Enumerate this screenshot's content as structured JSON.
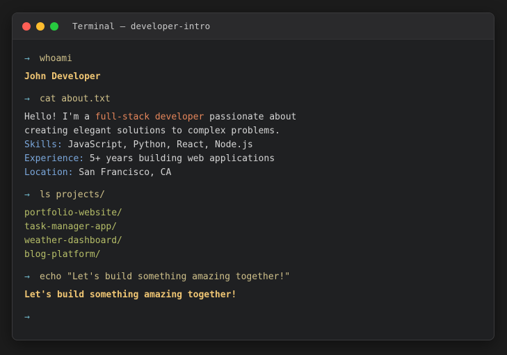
{
  "window": {
    "title": "Terminal — developer-intro"
  },
  "prompt_symbol": "→",
  "session": {
    "whoami": {
      "command": "whoami",
      "output": "John Developer"
    },
    "about": {
      "command": "cat about.txt",
      "intro_prefix": "Hello! I'm a ",
      "intro_highlight": "full-stack developer",
      "intro_suffix": " passionate about",
      "intro_line2": "creating elegant solutions to complex problems.",
      "skills_label": "Skills:",
      "skills_value": " JavaScript, Python, React, Node.js",
      "experience_label": "Experience:",
      "experience_value": " 5+ years building web applications",
      "location_label": "Location:",
      "location_value": " San Francisco, CA"
    },
    "projects": {
      "command": "ls projects/",
      "items": [
        "portfolio-website/",
        "task-manager-app/",
        "weather-dashboard/",
        "blog-platform/"
      ]
    },
    "echo": {
      "command": "echo \"Let's build something amazing together!\"",
      "output": "Let's build something amazing together!"
    }
  },
  "colors": {
    "prompt": "#6fb6c9",
    "command": "#cfc08a",
    "highlight": "#e5865b",
    "label": "#7aa6da",
    "directory": "#b5bd68",
    "emphasis_output": "#f0c674"
  }
}
